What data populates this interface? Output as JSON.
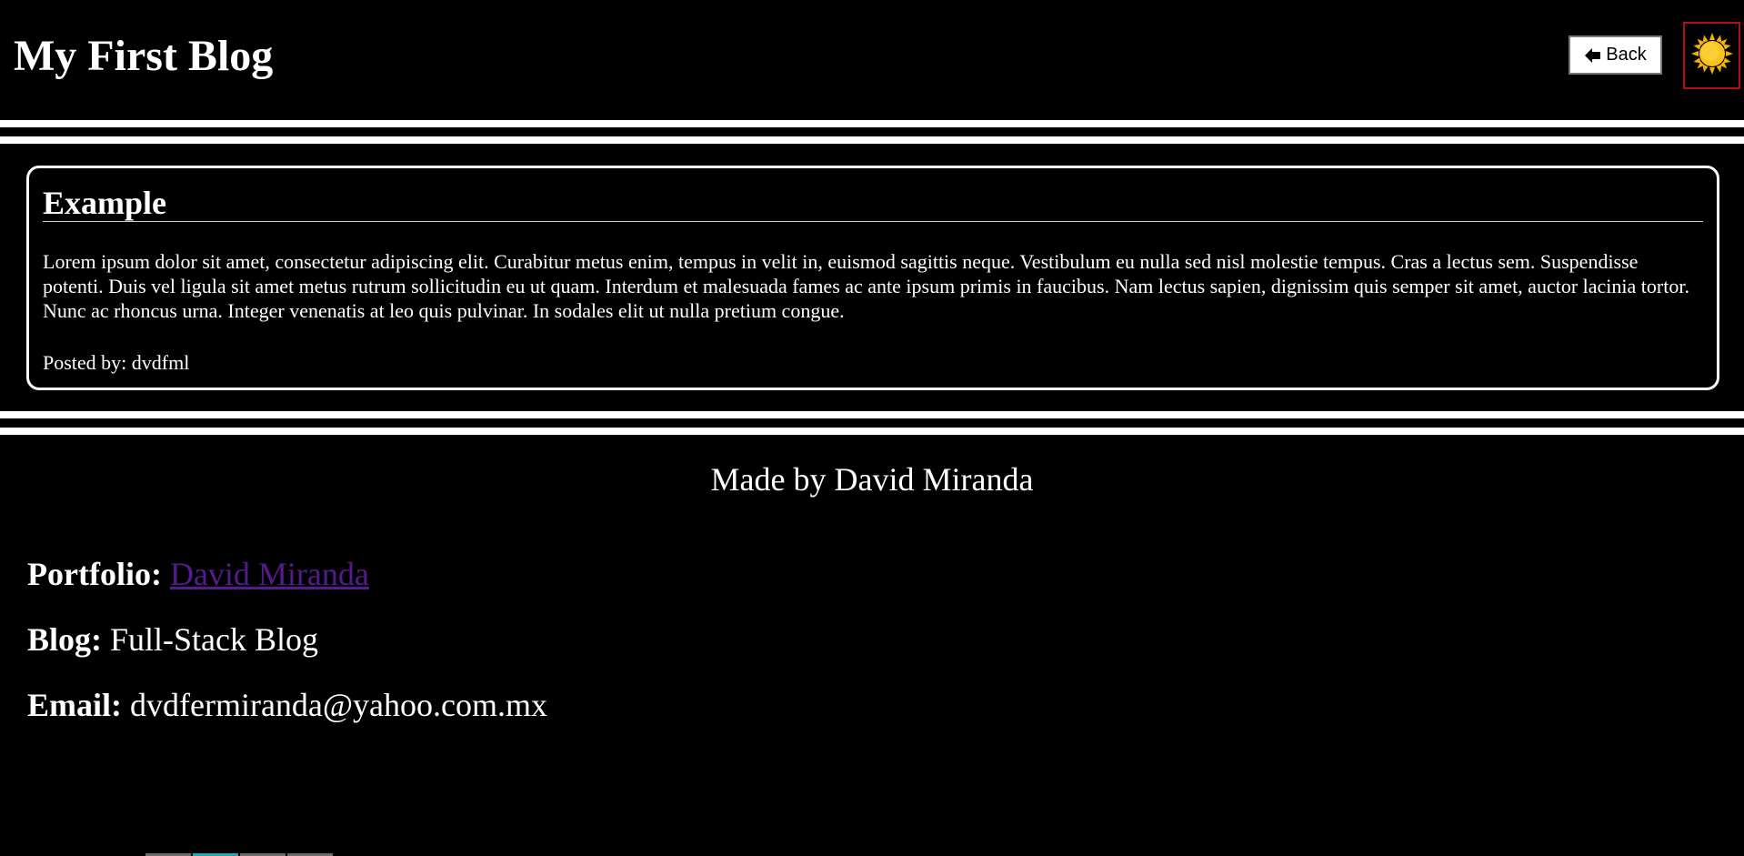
{
  "header": {
    "title": "My First Blog",
    "back_label": "Back",
    "theme_icon": "sun-icon"
  },
  "post": {
    "title": "Example",
    "body": "Lorem ipsum dolor sit amet, consectetur adipiscing elit. Curabitur metus enim, tempus in velit in, euismod sagittis neque. Vestibulum eu nulla sed nisl molestie tempus. Cras a lectus sem. Suspendisse potenti. Duis vel ligula sit amet metus rutrum sollicitudin eu ut quam. Interdum et malesuada fames ac ante ipsum primis in faucibus. Nam lectus sapien, dignissim quis semper sit amet, auctor lacinia tortor. Nunc ac rhoncus urna. Integer venenatis at leo quis pulvinar. In sodales elit ut nulla pretium congue.",
    "author_line": "Posted by: dvdfml"
  },
  "footer": {
    "credit": "Made by David Miranda",
    "portfolio_label": "Portfolio:",
    "portfolio_link": "David Miranda",
    "blog_label": "Blog:",
    "blog_value": "Full-Stack Blog",
    "email_label": "Email:",
    "email_value": "dvdfermiranda@yahoo.com.mx"
  },
  "colors": {
    "background": "#000000",
    "text": "#ffffff",
    "link": "#551a8b",
    "theme_toggle_border": "#b01010",
    "sun": "#f5b300"
  }
}
